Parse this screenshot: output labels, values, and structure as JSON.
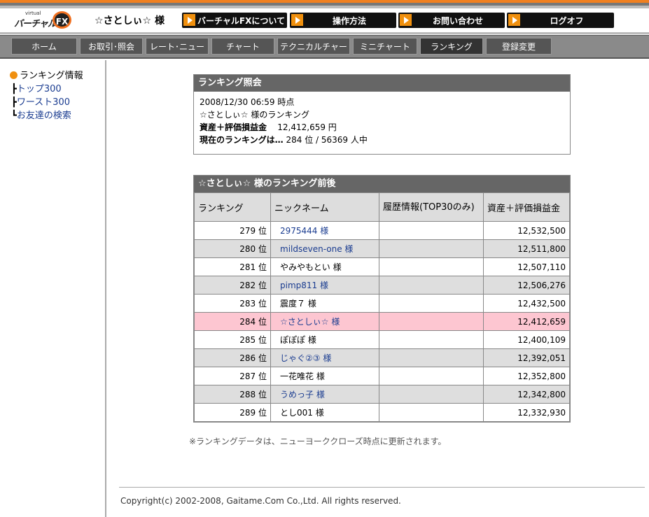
{
  "header": {
    "logo_small": "virtual",
    "logo_word": "バーチャル",
    "logo_fx": "FX",
    "username": "☆さとしぃ☆ 様",
    "buttons": [
      "バーチャルFXについて",
      "操作方法",
      "お問い合わせ",
      "ログオフ"
    ]
  },
  "nav": {
    "tabs": [
      "ホーム",
      "お取引･照会",
      "レート･ニュース",
      "チャート",
      "テクニカルチャート",
      "ミニチャート",
      "ランキング",
      "登録変更"
    ],
    "active": "ランキング"
  },
  "sidebar": {
    "title": "ランキング情報",
    "links": [
      {
        "tree": "┣",
        "label": "トップ300"
      },
      {
        "tree": "┣",
        "label": "ワースト300"
      },
      {
        "tree": "┗",
        "label": "お友達の検索"
      }
    ]
  },
  "info": {
    "title": "ランキング照会",
    "datetime": "2008/12/30  06:59 時点",
    "owner": "☆さとしぃ☆ 様のランキング",
    "asset_label": "資産＋評価損益金",
    "asset_value": "12,412,659 円",
    "rank_label": "現在のランキングは…",
    "rank_value": "284 位 / 56369 人中"
  },
  "ranking": {
    "title": "☆さとしぃ☆ 様のランキング前後",
    "columns": [
      "ランキング",
      "ニックネーム",
      "履歴情報(TOP30のみ)",
      "資産＋評価損益金"
    ],
    "rows": [
      {
        "rank": "279 位",
        "name": "2975444 様",
        "link": true,
        "history": "",
        "value": "12,532,500"
      },
      {
        "rank": "280 位",
        "name": "mildseven-one 様",
        "link": true,
        "history": "",
        "value": "12,511,800"
      },
      {
        "rank": "281 位",
        "name": "やみやもとい 様",
        "link": false,
        "history": "",
        "value": "12,507,110"
      },
      {
        "rank": "282 位",
        "name": "pimp811 様",
        "link": true,
        "history": "",
        "value": "12,506,276"
      },
      {
        "rank": "283 位",
        "name": "震度７ 様",
        "link": false,
        "history": "",
        "value": "12,432,500"
      },
      {
        "rank": "284 位",
        "name": "☆さとしぃ☆ 様",
        "link": true,
        "history": "",
        "value": "12,412,659",
        "highlight": true
      },
      {
        "rank": "285 位",
        "name": "ぽぽぽ 様",
        "link": false,
        "history": "",
        "value": "12,400,109"
      },
      {
        "rank": "286 位",
        "name": "じゃぐ②③ 様",
        "link": true,
        "history": "",
        "value": "12,392,051"
      },
      {
        "rank": "287 位",
        "name": "一花唯花 様",
        "link": false,
        "history": "",
        "value": "12,352,800"
      },
      {
        "rank": "288 位",
        "name": "うめっ子 様",
        "link": true,
        "history": "",
        "value": "12,342,800"
      },
      {
        "rank": "289 位",
        "name": "とし001 様",
        "link": false,
        "history": "",
        "value": "12,332,930"
      }
    ]
  },
  "note": "※ランキングデータは、ニューヨーククローズ時点に更新されます。",
  "copyright": "Copyright(c) 2002-2008, Gaitame.Com Co.,Ltd. All rights reserved.",
  "colors": {
    "accent": "#f09010",
    "header_bar": "#666666",
    "highlight_row": "#fdc6d1",
    "link": "#1a3c90"
  }
}
